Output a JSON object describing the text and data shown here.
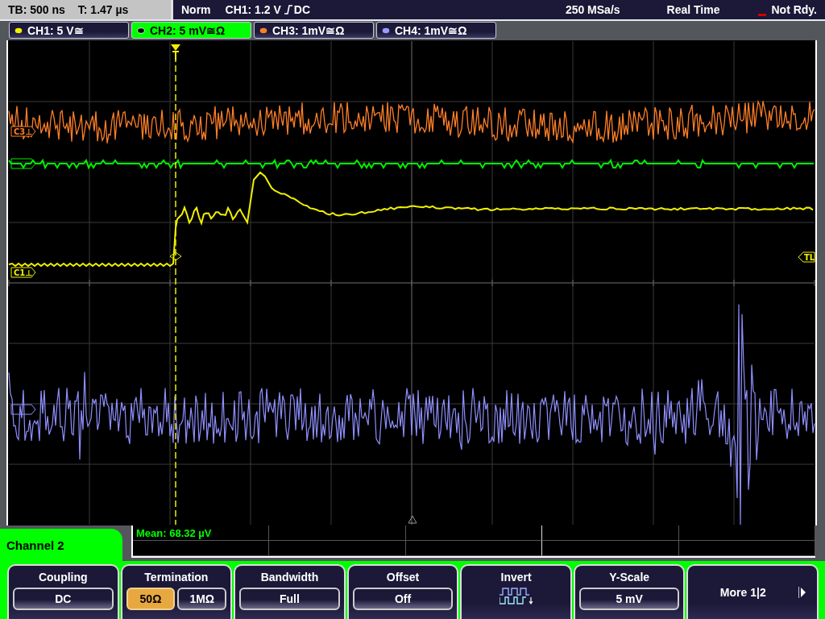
{
  "status_bar": {
    "timebase": "TB: 500 ns",
    "trigger_time": "T: 1.47 µs",
    "trigger_mode": "Norm",
    "trigger_source": "CH1: 1.2 V",
    "trigger_coupling": "DC",
    "sample_rate": "250 MSa/s",
    "acquisition_mode": "Real Time",
    "state": "Not Rdy."
  },
  "channel_tabs": [
    {
      "label": "CH1: 5 V≅",
      "color": "#f0f000",
      "selected": false
    },
    {
      "label": "CH2: 5 mV≅Ω",
      "color": "#00ff00",
      "selected": true
    },
    {
      "label": "CH3: 1mV≅Ω",
      "color": "#ff7f27",
      "selected": false
    },
    {
      "label": "CH4: 1mV≅Ω",
      "color": "#9a9aff",
      "selected": false
    }
  ],
  "waveform_markers": [
    {
      "label": "C3⊥",
      "color": "#ff7f27"
    },
    {
      "label": "C1⊥",
      "color": "#f0f000"
    }
  ],
  "trigger_level_label": "TL",
  "measurement": "Mean: 68.32 µV",
  "menu": {
    "title": "Channel 2",
    "softkeys": [
      {
        "kind": "value",
        "title": "Coupling",
        "value": "DC"
      },
      {
        "kind": "toggle",
        "title": "Termination",
        "options": [
          {
            "label": "50Ω",
            "selected": true
          },
          {
            "label": "1MΩ",
            "selected": false
          }
        ]
      },
      {
        "kind": "value",
        "title": "Bandwidth",
        "value": "Full"
      },
      {
        "kind": "value",
        "title": "Offset",
        "value": "Off"
      },
      {
        "kind": "icon",
        "title": "Invert"
      },
      {
        "kind": "value",
        "title": "Y-Scale",
        "value": "5 mV"
      },
      {
        "kind": "more",
        "label": "More 1|2"
      }
    ]
  }
}
